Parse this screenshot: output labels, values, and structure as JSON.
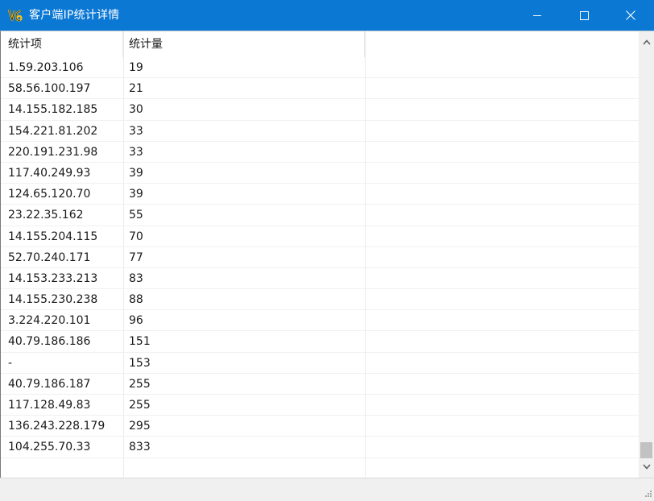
{
  "window": {
    "title": "客户端IP统计详情",
    "controls": {
      "minimize": "minimize-icon",
      "maximize": "maximize-icon",
      "close": "close-icon"
    }
  },
  "table": {
    "columns": [
      "统计项",
      "统计量",
      ""
    ],
    "rows": [
      [
        "1.59.203.106",
        "19"
      ],
      [
        "58.56.100.197",
        "21"
      ],
      [
        "14.155.182.185",
        "30"
      ],
      [
        "154.221.81.202",
        "33"
      ],
      [
        "220.191.231.98",
        "33"
      ],
      [
        "117.40.249.93",
        "39"
      ],
      [
        "124.65.120.70",
        "39"
      ],
      [
        "23.22.35.162",
        "55"
      ],
      [
        "14.155.204.115",
        "70"
      ],
      [
        "52.70.240.171",
        "77"
      ],
      [
        "14.153.233.213",
        "83"
      ],
      [
        "14.155.230.238",
        "88"
      ],
      [
        "3.224.220.101",
        "96"
      ],
      [
        "40.79.186.186",
        "151"
      ],
      [
        "-",
        "153"
      ],
      [
        "40.79.186.187",
        "255"
      ],
      [
        "117.128.49.83",
        "255"
      ],
      [
        "136.243.228.179",
        "295"
      ],
      [
        "104.255.70.33",
        "833"
      ]
    ]
  },
  "scrollbar": {
    "position": 0.98
  },
  "colors": {
    "titlebar": "#0b78d4",
    "titlebar_text": "#ffffff"
  }
}
